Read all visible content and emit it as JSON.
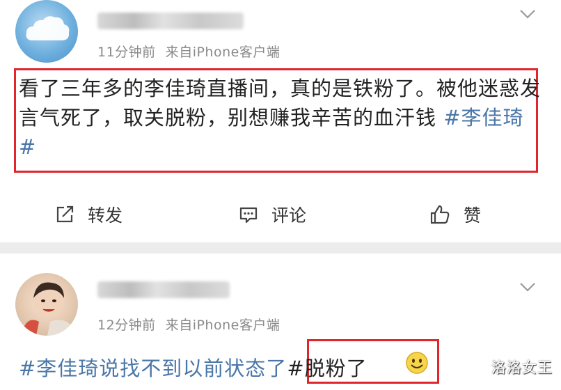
{
  "posts": [
    {
      "time": "11分钟前",
      "source": "来自iPhone客户端",
      "content_text": "看了三年多的李佳琦直播间，真的是铁粉了。被他迷惑发言气死了，取关脱粉，别想赚我辛苦的血汗钱 ",
      "hashtag": "#李佳琦#",
      "actions": {
        "repost": "转发",
        "comment": "评论",
        "like": "赞"
      }
    },
    {
      "time": "12分钟前",
      "source": "来自iPhone客户端",
      "content_prefix": "#李佳琦说找不到以前状态了",
      "content_highlight": "#脱粉了",
      "emoji": "smile-emoji"
    }
  ],
  "watermark": "洛洛女王",
  "colors": {
    "highlight_border": "#e0252b",
    "hashtag": "#4a76a8",
    "meta": "#8a8a8a",
    "separator": "#ececec"
  }
}
